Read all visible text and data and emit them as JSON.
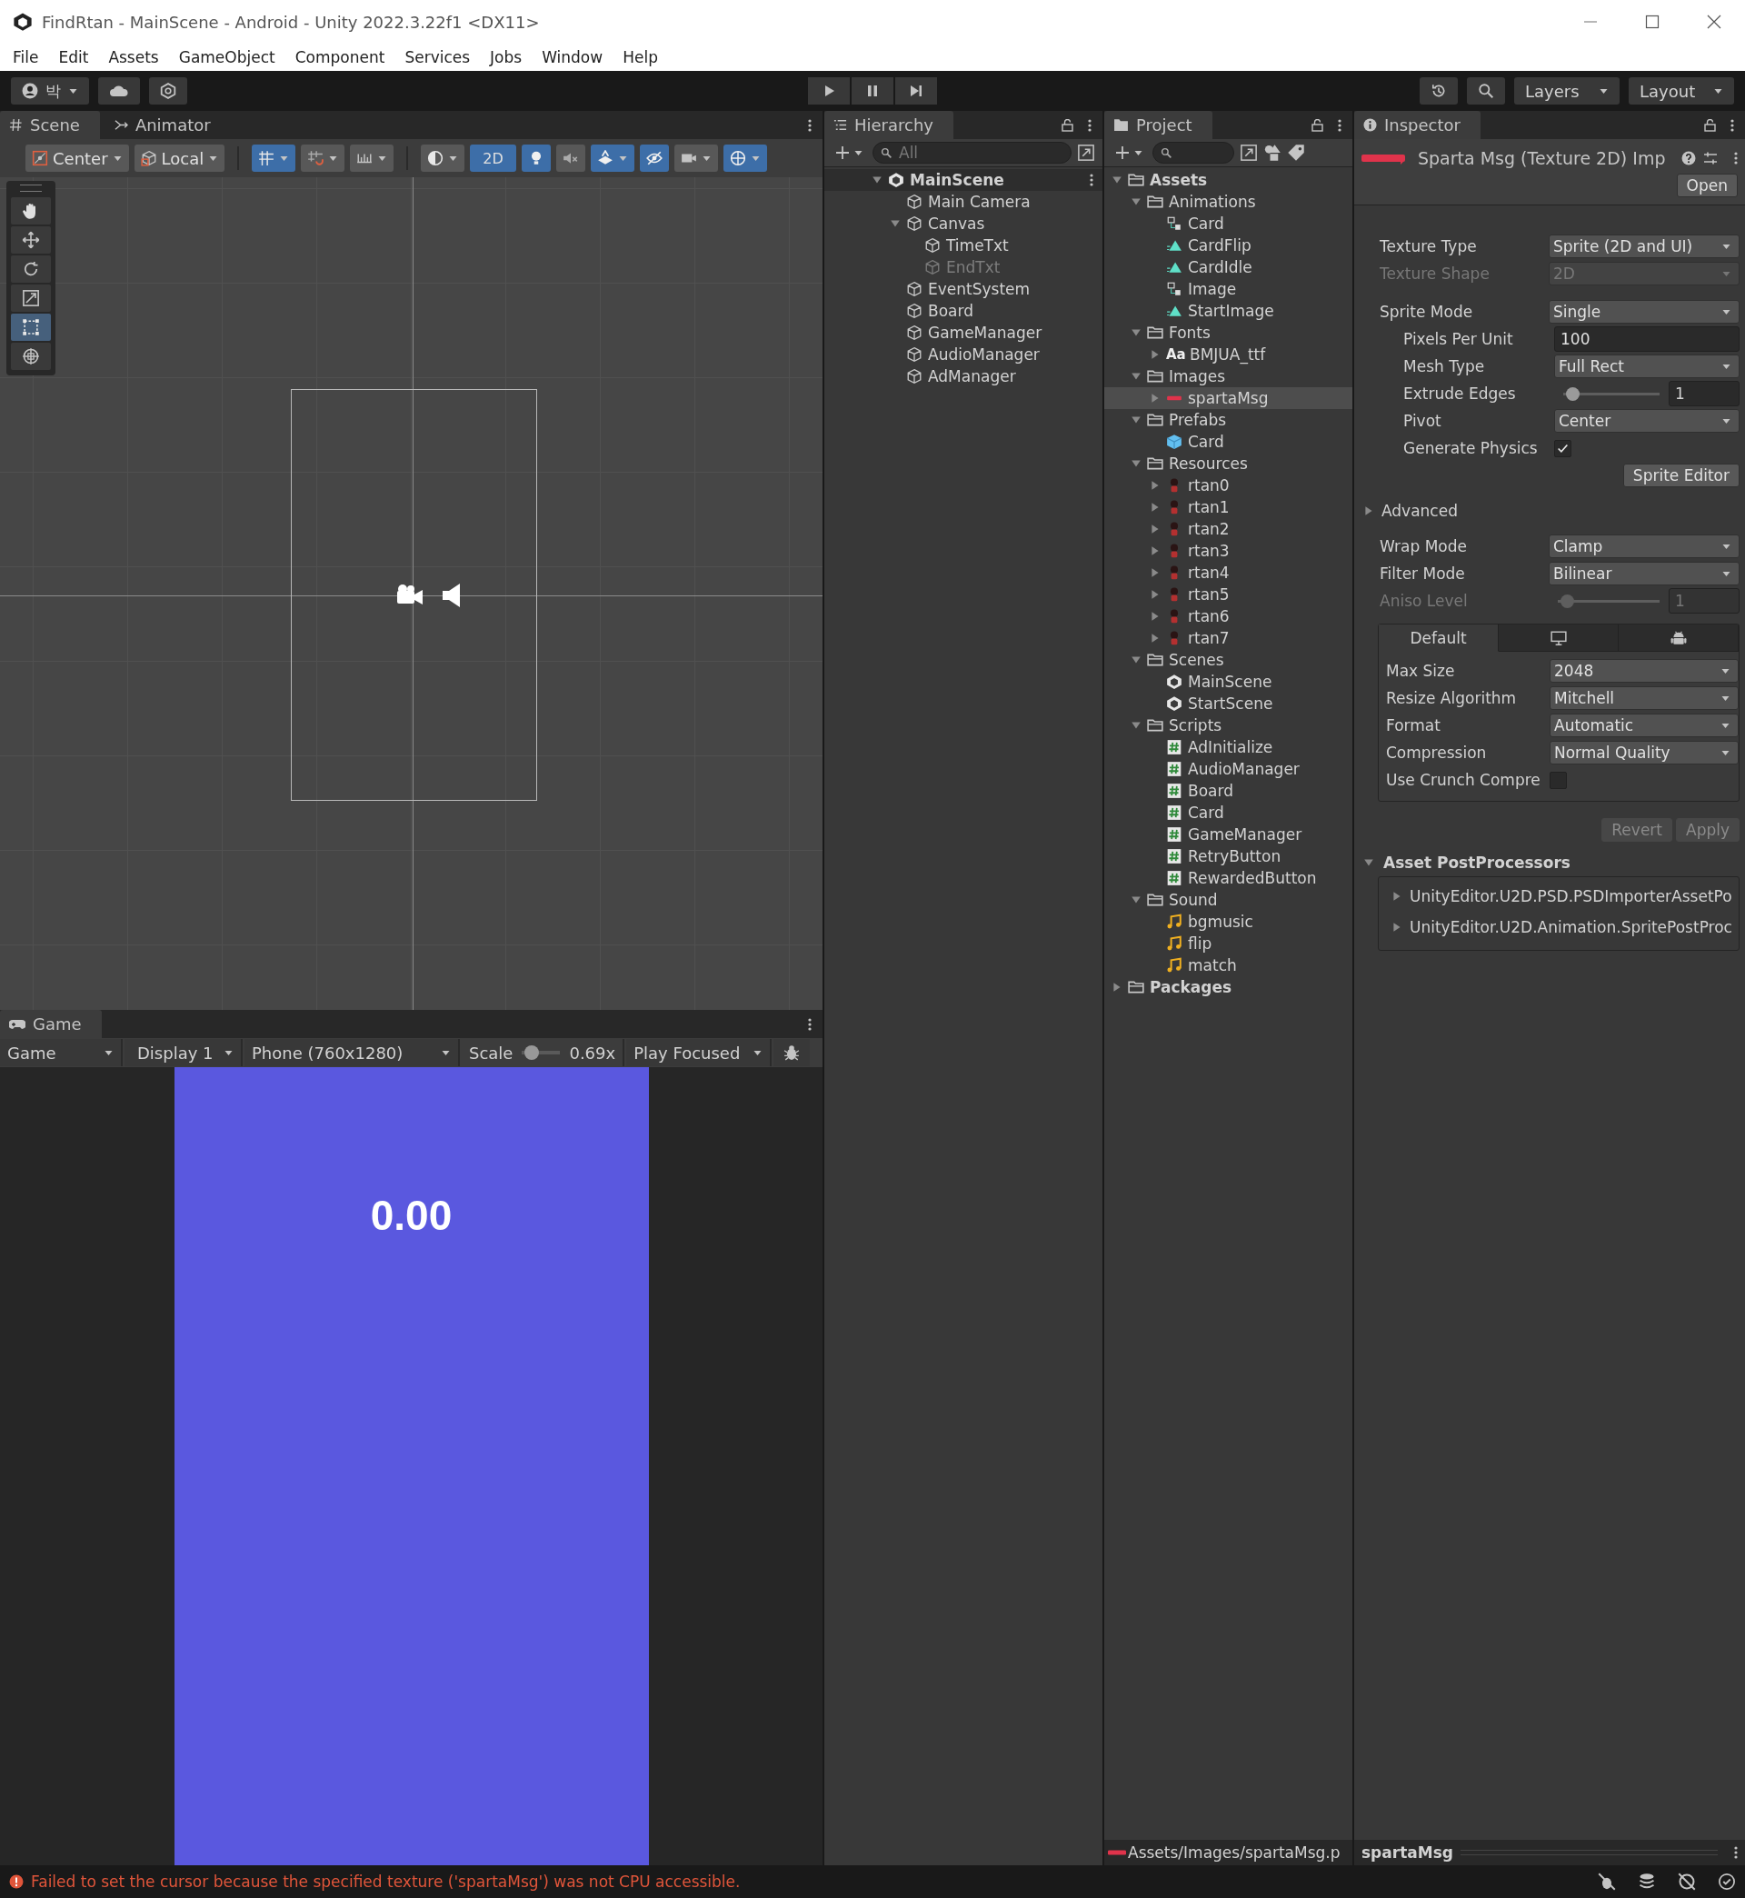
{
  "window": {
    "title": "FindRtan - MainScene - Android - Unity 2022.3.22f1 <DX11>"
  },
  "menu": [
    "File",
    "Edit",
    "Assets",
    "GameObject",
    "Component",
    "Services",
    "Jobs",
    "Window",
    "Help"
  ],
  "toolbar": {
    "account": "박",
    "layers": "Layers",
    "layout": "Layout"
  },
  "scene_panel": {
    "tabs": [
      {
        "label": "Scene",
        "kind": "scene",
        "selected": true
      },
      {
        "label": "Animator",
        "kind": "animator",
        "selected": false
      }
    ],
    "pivot": "Center",
    "space": "Local",
    "toggles": [
      {
        "kind": "grid",
        "on": true
      },
      {
        "kind": "snap",
        "on": false
      },
      {
        "kind": "increment",
        "on": false
      },
      {
        "kind": "shading",
        "on": false
      },
      {
        "kind": "dimension",
        "label": "2D",
        "on": true
      },
      {
        "kind": "lighting",
        "on": true
      },
      {
        "kind": "audio",
        "on": false
      },
      {
        "kind": "effects",
        "on": true
      },
      {
        "kind": "visibility",
        "on": true
      },
      {
        "kind": "camera",
        "on": false
      },
      {
        "kind": "gizmos",
        "on": true
      }
    ],
    "tools": [
      {
        "kind": "hand",
        "selected": false
      },
      {
        "kind": "move",
        "selected": false
      },
      {
        "kind": "rotate",
        "selected": false
      },
      {
        "kind": "scale",
        "selected": false
      },
      {
        "kind": "rect",
        "selected": true
      },
      {
        "kind": "transform",
        "selected": false
      }
    ]
  },
  "game_panel": {
    "tab": "Game",
    "view": "Game",
    "display": "Display 1",
    "resolution": "Phone (760x1280)",
    "scale_label": "Scale",
    "scale_value": "0.69x",
    "scale": {
      "level": 0.1
    },
    "play_mode": "Play Focused",
    "timer": "0.00"
  },
  "hierarchy": {
    "tab": "Hierarchy",
    "search_placeholder": "All",
    "items": [
      {
        "label": "MainScene",
        "kind": "scene",
        "active": true,
        "expanded": true,
        "children": [
          {
            "label": "Main Camera",
            "kind": "object",
            "active": true
          },
          {
            "label": "Canvas",
            "kind": "object",
            "active": true,
            "expanded": true,
            "children": [
              {
                "label": "TimeTxt",
                "kind": "object",
                "active": true
              },
              {
                "label": "EndTxt",
                "kind": "object",
                "active": false
              }
            ]
          },
          {
            "label": "EventSystem",
            "kind": "object",
            "active": true
          },
          {
            "label": "Board",
            "kind": "object",
            "active": true
          },
          {
            "label": "GameManager",
            "kind": "object",
            "active": true
          },
          {
            "label": "AudioManager",
            "kind": "object",
            "active": true
          },
          {
            "label": "AdManager",
            "kind": "object",
            "active": true
          }
        ]
      }
    ]
  },
  "project": {
    "tab": "Project",
    "items": [
      {
        "label": "Assets",
        "kind": "folder",
        "selected": false,
        "expanded": true,
        "children": [
          {
            "label": "Animations",
            "kind": "folder",
            "selected": false,
            "expanded": true,
            "children": [
              {
                "label": "Card",
                "kind": "controller",
                "selected": false
              },
              {
                "label": "CardFlip",
                "kind": "clip",
                "selected": false
              },
              {
                "label": "CardIdle",
                "kind": "clip",
                "selected": false
              },
              {
                "label": "Image",
                "kind": "controller",
                "selected": false
              },
              {
                "label": "StartImage",
                "kind": "clip",
                "selected": false
              }
            ]
          },
          {
            "label": "Fonts",
            "kind": "folder",
            "selected": false,
            "expanded": true,
            "children": [
              {
                "label": "BMJUA_ttf",
                "kind": "font",
                "icon_text": "Aa",
                "selected": false,
                "expanded": false
              }
            ]
          },
          {
            "label": "Images",
            "kind": "folder",
            "selected": false,
            "expanded": true,
            "children": [
              {
                "label": "spartaMsg",
                "kind": "sprite",
                "selected": true,
                "expanded": false
              }
            ]
          },
          {
            "label": "Prefabs",
            "kind": "folder",
            "selected": false,
            "expanded": true,
            "children": [
              {
                "label": "Card",
                "kind": "prefab",
                "selected": false
              }
            ]
          },
          {
            "label": "Resources",
            "kind": "folder",
            "selected": false,
            "expanded": true,
            "children": [
              {
                "label": "rtan0",
                "kind": "character",
                "selected": false,
                "expanded": false
              },
              {
                "label": "rtan1",
                "kind": "character",
                "selected": false,
                "expanded": false
              },
              {
                "label": "rtan2",
                "kind": "character",
                "selected": false,
                "expanded": false
              },
              {
                "label": "rtan3",
                "kind": "character",
                "selected": false,
                "expanded": false
              },
              {
                "label": "rtan4",
                "kind": "character",
                "selected": false,
                "expanded": false
              },
              {
                "label": "rtan5",
                "kind": "character",
                "selected": false,
                "expanded": false
              },
              {
                "label": "rtan6",
                "kind": "character",
                "selected": false,
                "expanded": false
              },
              {
                "label": "rtan7",
                "kind": "character",
                "selected": false,
                "expanded": false
              }
            ]
          },
          {
            "label": "Scenes",
            "kind": "folder",
            "selected": false,
            "expanded": true,
            "children": [
              {
                "label": "MainScene",
                "kind": "scene",
                "selected": false
              },
              {
                "label": "StartScene",
                "kind": "scene",
                "selected": false
              }
            ]
          },
          {
            "label": "Scripts",
            "kind": "folder",
            "selected": false,
            "expanded": true,
            "children": [
              {
                "label": "AdInitialize",
                "kind": "script",
                "selected": false
              },
              {
                "label": "AudioManager",
                "kind": "script",
                "selected": false
              },
              {
                "label": "Board",
                "kind": "script",
                "selected": false
              },
              {
                "label": "Card",
                "kind": "script",
                "selected": false
              },
              {
                "label": "GameManager",
                "kind": "script",
                "selected": false
              },
              {
                "label": "RetryButton",
                "kind": "script",
                "selected": false
              },
              {
                "label": "RewardedButton",
                "kind": "script",
                "selected": false
              }
            ]
          },
          {
            "label": "Sound",
            "kind": "folder",
            "selected": false,
            "expanded": true,
            "children": [
              {
                "label": "bgmusic",
                "kind": "audio",
                "selected": false
              },
              {
                "label": "flip",
                "kind": "audio",
                "selected": false
              },
              {
                "label": "match",
                "kind": "audio",
                "selected": false
              }
            ]
          }
        ]
      },
      {
        "label": "Packages",
        "kind": "folder",
        "selected": false,
        "expanded": false
      }
    ],
    "path": "Assets/Images/spartaMsg.p"
  },
  "inspector": {
    "tab": "Inspector",
    "title": "Sparta Msg (Texture 2D) Imp",
    "open": "Open",
    "fields": [
      {
        "kind": "dropdown",
        "label": "Texture Type",
        "value": "Sprite (2D and UI)",
        "disabled": false
      },
      {
        "kind": "dropdown",
        "label": "Texture Shape",
        "value": "2D",
        "disabled": true
      },
      {
        "kind": "dropdown",
        "label": "Sprite Mode",
        "value": "Single",
        "disabled": false,
        "children": [
          {
            "kind": "text",
            "label": "Pixels Per Unit",
            "value": "100",
            "disabled": false
          },
          {
            "kind": "dropdown",
            "label": "Mesh Type",
            "value": "Full Rect",
            "disabled": false
          },
          {
            "kind": "slider",
            "label": "Extrude Edges",
            "value": "1",
            "level": 0.03,
            "disabled": false
          },
          {
            "kind": "dropdown",
            "label": "Pivot",
            "value": "Center",
            "disabled": false
          },
          {
            "kind": "checkbox",
            "label": "Generate Physics",
            "checked": true,
            "disabled": false
          }
        ]
      },
      {
        "kind": "button",
        "label": "Sprite Editor"
      },
      {
        "kind": "foldout",
        "label": "Advanced",
        "expanded": false
      },
      {
        "kind": "dropdown",
        "label": "Wrap Mode",
        "value": "Clamp",
        "disabled": false
      },
      {
        "kind": "dropdown",
        "label": "Filter Mode",
        "value": "Bilinear",
        "disabled": false
      },
      {
        "kind": "slider",
        "label": "Aniso Level",
        "value": "1",
        "level": 0.03,
        "disabled": true
      }
    ],
    "platform_tabs": [
      {
        "kind": "text",
        "label": "Default",
        "selected": true
      },
      {
        "kind": "desktop",
        "selected": false
      },
      {
        "kind": "android",
        "selected": false
      }
    ],
    "platform_fields": [
      {
        "kind": "dropdown",
        "label": "Max Size",
        "value": "2048",
        "disabled": false
      },
      {
        "kind": "dropdown",
        "label": "Resize Algorithm",
        "value": "Mitchell",
        "disabled": false
      },
      {
        "kind": "dropdown",
        "label": "Format",
        "value": "Automatic",
        "disabled": false
      },
      {
        "kind": "dropdown",
        "label": "Compression",
        "value": "Normal Quality",
        "disabled": false
      },
      {
        "kind": "checkbox",
        "label": "Use Crunch Compre",
        "checked": false,
        "disabled": false
      }
    ],
    "actions": [
      "Revert",
      "Apply"
    ],
    "postprocessors": {
      "label": "Asset PostProcessors",
      "expanded": true,
      "items": [
        {
          "label": "UnityEditor.U2D.PSD.PSDImporterAssetPo",
          "expanded": false
        },
        {
          "label": "UnityEditor.U2D.Animation.SpritePostProc",
          "expanded": false
        }
      ]
    },
    "preview": "spartaMsg"
  },
  "status": {
    "kind": "error",
    "message": "Failed to set the cursor because the specified texture ('spartaMsg') was not CPU accessible."
  }
}
